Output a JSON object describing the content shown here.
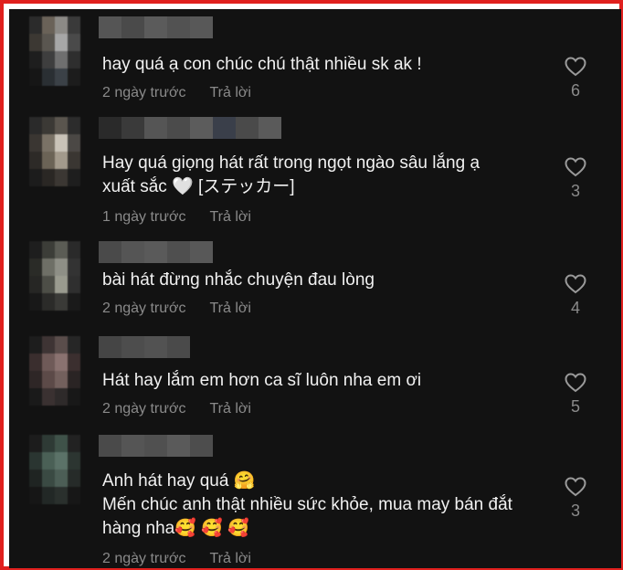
{
  "comments": [
    {
      "text": "hay quá ạ con chúc chú thật nhiều sk ak !",
      "time": "2 ngày trước",
      "reply": "Trả lời",
      "likes": "6",
      "avatar_colors": [
        "#2b2b2b",
        "#6a6258",
        "#8c8a86",
        "#3a3a3a",
        "#3c3833",
        "#5a5650",
        "#a7a7a7",
        "#4a4a4a",
        "#1e1e1e",
        "#3e3e3e",
        "#6f6f6f",
        "#2e2e2e",
        "#161616",
        "#2a2f33",
        "#3b4147",
        "#1c1c1c"
      ],
      "username_colors": [
        "#555555",
        "#4a4a4a",
        "#5b5b5b",
        "#525252",
        "#585858"
      ]
    },
    {
      "text": "Hay quá giọng hát rất trong ngọt ngào sâu lắng ạ\nxuất sắc 🤍 [ステッカー]",
      "time": "1 ngày trước",
      "reply": "Trả lời",
      "likes": "3",
      "avatar_colors": [
        "#2a2a2a",
        "#3b3935",
        "#5a554e",
        "#2c2c2c",
        "#3a3632",
        "#7a7266",
        "#c9c3b8",
        "#4b4845",
        "#2d2a27",
        "#6b6356",
        "#a39a8c",
        "#3a3632",
        "#1c1c1c",
        "#2a2724",
        "#3b3733",
        "#1e1e1e"
      ],
      "username_colors": [
        "#2a2a2a",
        "#3a3a3a",
        "#555555",
        "#4b4b4b",
        "#5c5c5c",
        "#3a3f4a",
        "#4a4a4a",
        "#5a5a5a"
      ]
    },
    {
      "text": "bài hát đừng nhắc chuyện đau lòng",
      "time": "2 ngày trước",
      "reply": "Trả lời",
      "likes": "4",
      "avatar_colors": [
        "#1e1e1e",
        "#3c3d38",
        "#5b5c55",
        "#2a2a2a",
        "#2a2b27",
        "#6e6f66",
        "#8e8f86",
        "#333333",
        "#262624",
        "#4d4e47",
        "#9a9b8f",
        "#2f2f2f",
        "#181818",
        "#2b2b29",
        "#3a3a37",
        "#1a1a1a"
      ],
      "username_colors": [
        "#4a4a4a",
        "#555555",
        "#5a5a5a",
        "#4f4f4f",
        "#585858"
      ]
    },
    {
      "text": "Hát hay lắm em hơn ca sĩ luôn nha em ơi",
      "time": "2 ngày trước",
      "reply": "Trả lời",
      "likes": "5",
      "avatar_colors": [
        "#1d1d1d",
        "#3e3434",
        "#5a4d4b",
        "#262626",
        "#3a2e2e",
        "#6f5a58",
        "#8a7270",
        "#3b2f2f",
        "#2e2626",
        "#5c4a48",
        "#73605d",
        "#2a2424",
        "#1a1a1a",
        "#3a3131",
        "#2e2a2a",
        "#181818"
      ],
      "username_colors": [
        "#454545",
        "#4d4d4d",
        "#525252",
        "#4a4a4a"
      ]
    },
    {
      "text": "Anh hát hay quá 🤗\nMến chúc anh thật nhiều sức khỏe, mua may bán đắt\nhàng nha🥰 🥰 🥰",
      "time": "2 ngày trước",
      "reply": "Trả lời",
      "likes": "3",
      "avatar_colors": [
        "#1c1c1c",
        "#2e3a35",
        "#3f5249",
        "#222222",
        "#2a3531",
        "#4a6056",
        "#5b7268",
        "#2c3531",
        "#1f2422",
        "#3a4a43",
        "#4c5e56",
        "#262b29",
        "#161616",
        "#222826",
        "#2a302d",
        "#171717"
      ],
      "username_colors": [
        "#4a4a4a",
        "#555555",
        "#505050",
        "#5a5a5a",
        "#4d4d4d"
      ]
    }
  ],
  "colors": {
    "frame": "#e0201e",
    "panel": "#121212",
    "text": "#f1f1f1",
    "meta": "#8a8a8a"
  }
}
